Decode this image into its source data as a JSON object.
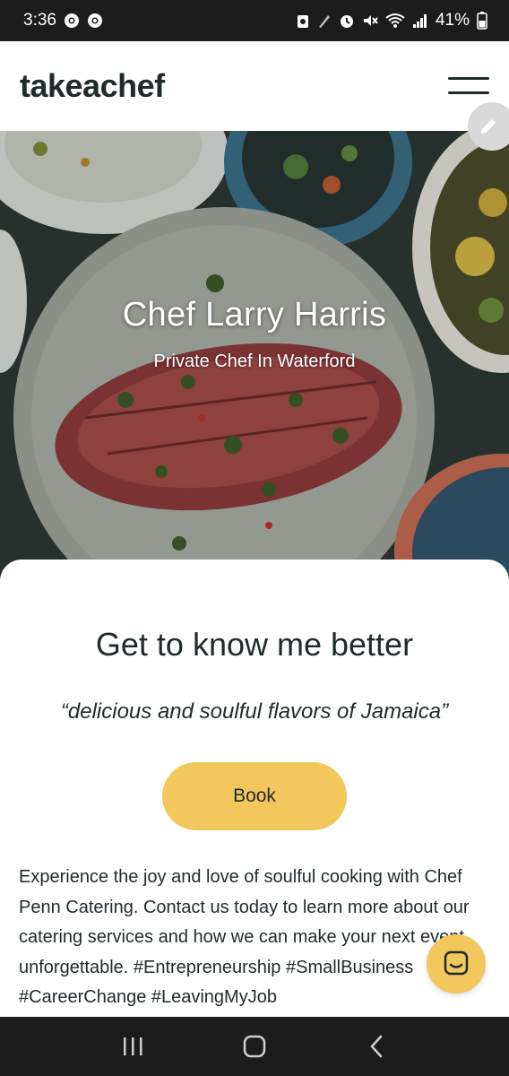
{
  "status_bar": {
    "time": "3:36",
    "battery": "41%"
  },
  "header": {
    "logo": "takeachef"
  },
  "hero": {
    "title": "Chef Larry Harris",
    "subtitle": "Private Chef In Waterford"
  },
  "content": {
    "heading": "Get to know me better",
    "quote": "“delicious and soulful flavors of Jamaica”",
    "book_label": "Book",
    "bio": "Experience the joy and love of soulful cooking with Chef Penn Catering. Contact us today to learn more about our catering services and how we can make your next event unforgettable. #Entrepreneurship #SmallBusiness #CareerChange #LeavingMyJob"
  },
  "colors": {
    "accent": "#f2c75c",
    "text_dark": "#1f2a2c",
    "system_bar": "#1c1c1c"
  },
  "icons": {
    "menu": "hamburger-icon",
    "edit": "pencil-icon",
    "chat": "chat-icon",
    "nav_recents": "recents-icon",
    "nav_home": "home-icon",
    "nav_back": "back-icon"
  }
}
